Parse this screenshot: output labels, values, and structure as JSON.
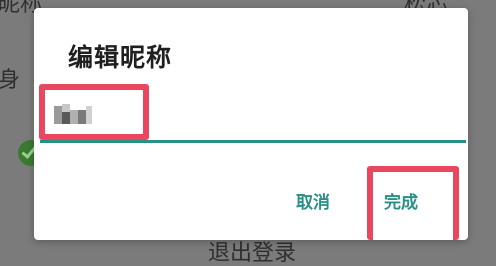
{
  "background": {
    "nickname_label": "昵称",
    "nickname_value": "松芯",
    "identity_label": "身",
    "logout_label": "退出登录"
  },
  "dialog": {
    "title": "编辑昵称",
    "input_value": "",
    "cancel_label": "取消",
    "done_label": "完成"
  },
  "colors": {
    "accent": "#2a8f86",
    "highlight": "#e8475f",
    "overlay": "#7b7b7b"
  }
}
